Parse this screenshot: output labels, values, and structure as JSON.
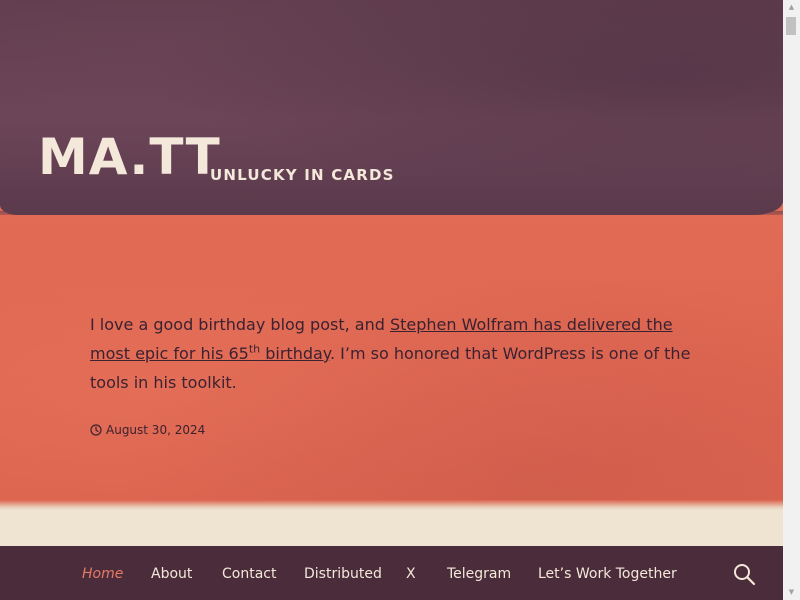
{
  "header": {
    "site_title": "MA.TT",
    "tagline": "UNLUCKY IN CARDS"
  },
  "post": {
    "text_before": "I love a good birthday blog post, and ",
    "link_text": "Stephen Wolfram has delivered the most epic for his 65",
    "link_sup": "th",
    "link_after": " birthday",
    "text_after": ". I’m so honored that WordPress is one of the tools in his toolkit.",
    "date": "August 30, 2024",
    "date_icon": "clock-icon"
  },
  "nav": {
    "items": [
      {
        "label": "Home",
        "current": true
      },
      {
        "label": "About",
        "current": false
      },
      {
        "label": "Contact",
        "current": false
      },
      {
        "label": "Distributed",
        "current": false
      },
      {
        "label": "X",
        "current": false
      },
      {
        "label": "Telegram",
        "current": false
      },
      {
        "label": "Let’s Work Together",
        "current": false
      }
    ],
    "search_icon": "search-icon"
  },
  "scrollbar": {
    "up_arrow": "▲",
    "down_arrow": "▼"
  },
  "colors": {
    "header_purple": "#5e3b4d",
    "content_coral": "#e06a53",
    "nav_bg": "#4b2c3b",
    "nav_current": "#e57a66",
    "cream": "#efe3d2",
    "text_dark": "#3b2230"
  }
}
